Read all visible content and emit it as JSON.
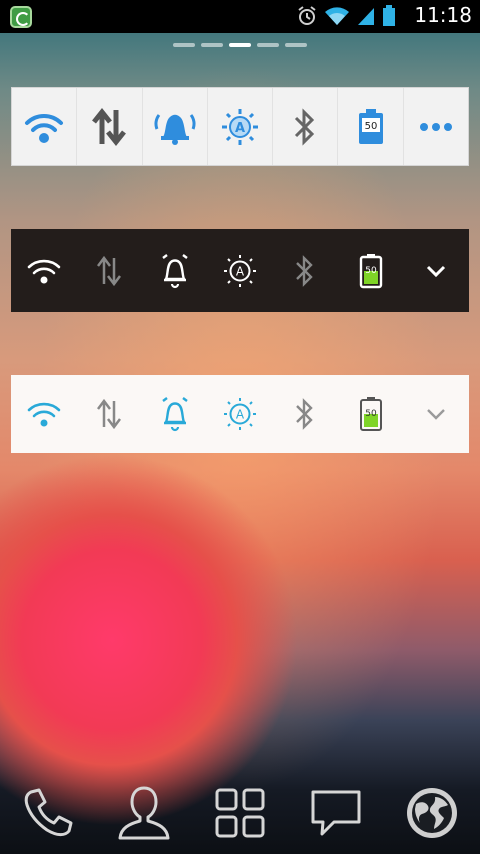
{
  "status_bar": {
    "time": "11:18",
    "icons": [
      "app-notification-icon",
      "alarm-icon",
      "wifi-icon",
      "signal-icon",
      "battery-icon"
    ]
  },
  "home_pager": {
    "pages": 5,
    "active_page": 3
  },
  "widgets": [
    {
      "style": "light-blue",
      "toggles": [
        "wifi-icon",
        "data-sync-icon",
        "alarm-icon",
        "brightness-auto-icon",
        "bluetooth-icon",
        "battery-icon",
        "more-icon"
      ],
      "battery_level": "50",
      "brightness_mode": "A",
      "colors": {
        "background": "#f2f2f2",
        "accent": "#2f8ddd",
        "inactive": "#555555"
      }
    },
    {
      "style": "dark",
      "toggles": [
        "wifi-icon",
        "data-sync-icon",
        "alarm-icon",
        "brightness-auto-icon",
        "bluetooth-icon",
        "battery-icon",
        "expand-icon"
      ],
      "battery_level": "50",
      "brightness_mode": "A",
      "colors": {
        "background": "#231d1b",
        "accent": "#ffffff",
        "inactive": "#888888"
      }
    },
    {
      "style": "light-cyan",
      "toggles": [
        "wifi-icon",
        "data-sync-icon",
        "alarm-icon",
        "brightness-auto-icon",
        "bluetooth-icon",
        "battery-icon",
        "expand-icon"
      ],
      "battery_level": "50",
      "brightness_mode": "A",
      "colors": {
        "background": "#fbf8f6",
        "accent": "#29a9d8",
        "inactive": "#888888"
      }
    }
  ],
  "dock": {
    "items": [
      "phone-icon",
      "contacts-icon",
      "app-drawer-icon",
      "messaging-icon",
      "browser-icon"
    ]
  }
}
